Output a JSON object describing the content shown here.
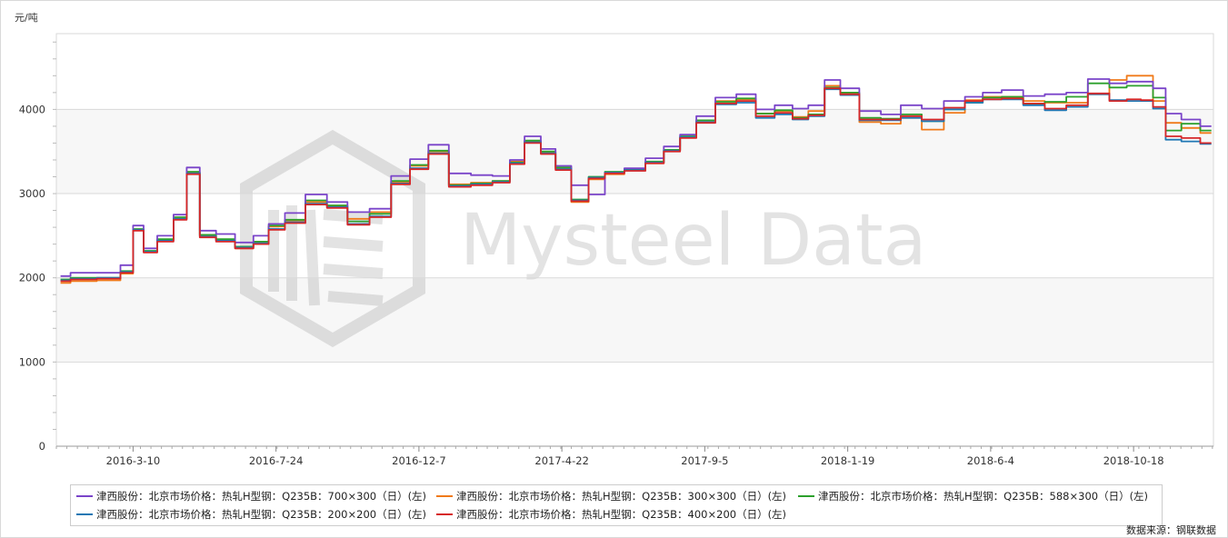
{
  "y_unit_label": "元/吨",
  "source_label": "数据来源：钢联数据",
  "watermark": "Mysteel Data",
  "colors": {
    "s700x300": "#7a44c9",
    "s300x300": "#f07a1a",
    "s588x300": "#2ca02c",
    "s200x200": "#1f77b4",
    "s400x200": "#d62728"
  },
  "chart_data": {
    "type": "line",
    "title": "",
    "xlabel": "",
    "ylabel": "元/吨",
    "ylim": [
      0,
      4900
    ],
    "yticks": [
      0,
      1000,
      2000,
      3000,
      4000
    ],
    "grid": true,
    "legend_position": "bottom",
    "x_tick_labels": [
      "2016-3-10",
      "2016-7-24",
      "2016-12-7",
      "2017-4-22",
      "2017-9-5",
      "2018-1-19",
      "2018-6-4",
      "2018-10-18"
    ],
    "x": [
      "2016-1-1",
      "2016-1-20",
      "2016-2-20",
      "2016-3-5",
      "2016-3-15",
      "2016-3-25",
      "2016-4-10",
      "2016-4-25",
      "2016-5-5",
      "2016-5-20",
      "2016-6-5",
      "2016-6-25",
      "2016-7-10",
      "2016-7-24",
      "2016-8-10",
      "2016-9-1",
      "2016-9-20",
      "2016-10-10",
      "2016-11-1",
      "2016-11-20",
      "2016-12-7",
      "2016-12-25",
      "2017-1-15",
      "2017-2-5",
      "2017-2-25",
      "2017-3-10",
      "2017-3-25",
      "2017-4-10",
      "2017-4-22",
      "2017-5-10",
      "2017-5-25",
      "2017-6-10",
      "2017-7-1",
      "2017-7-20",
      "2017-8-5",
      "2017-8-20",
      "2017-9-5",
      "2017-9-25",
      "2017-10-15",
      "2017-11-1",
      "2017-11-20",
      "2017-12-5",
      "2017-12-20",
      "2018-1-5",
      "2018-1-19",
      "2018-2-10",
      "2018-3-1",
      "2018-3-20",
      "2018-4-10",
      "2018-5-1",
      "2018-5-20",
      "2018-6-4",
      "2018-6-25",
      "2018-7-15",
      "2018-8-5",
      "2018-8-25",
      "2018-9-15",
      "2018-10-5",
      "2018-10-18",
      "2018-11-1",
      "2018-11-10",
      "2018-11-25",
      "2018-12-10",
      "2018-12-31"
    ],
    "series": [
      {
        "name": "津西股份：北京市场价格：热轧H型钢：Q235B：700×300（日）(左)",
        "color_key": "s700x300",
        "values": [
          2020,
          2060,
          2060,
          2150,
          2620,
          2350,
          2500,
          2750,
          3310,
          2560,
          2520,
          2420,
          2500,
          2640,
          2770,
          2990,
          2900,
          2780,
          2820,
          3210,
          3410,
          3580,
          3240,
          3220,
          3210,
          3400,
          3680,
          3530,
          3330,
          3100,
          2990,
          3250,
          3300,
          3420,
          3560,
          3700,
          3920,
          4140,
          4180,
          4000,
          4050,
          4010,
          4050,
          4350,
          4250,
          3980,
          3940,
          4050,
          4010,
          4100,
          4150,
          4200,
          4230,
          4160,
          4180,
          4200,
          4360,
          4310,
          4330,
          4330,
          4250,
          3950,
          3880,
          3800
        ]
      },
      {
        "name": "津西股份：北京市场价格：热轧H型钢：Q235B：300×300（日）(左)",
        "color_key": "s300x300",
        "values": [
          1940,
          1960,
          1970,
          2050,
          2570,
          2310,
          2450,
          2700,
          3250,
          2500,
          2450,
          2350,
          2420,
          2610,
          2680,
          2900,
          2850,
          2700,
          2780,
          3140,
          3330,
          3500,
          3110,
          3130,
          3150,
          3380,
          3620,
          3490,
          3300,
          2900,
          3170,
          3230,
          3280,
          3360,
          3510,
          3670,
          3870,
          4100,
          4120,
          3950,
          3980,
          3910,
          3980,
          4280,
          4190,
          3850,
          3830,
          3900,
          3760,
          3960,
          4110,
          4150,
          4150,
          4100,
          4080,
          4080,
          4180,
          4350,
          4400,
          4400,
          4100,
          3840,
          3780,
          3720
        ]
      },
      {
        "name": "津西股份：北京市场价格：热轧H型钢：Q235B：588×300（日）(左)",
        "color_key": "s588x300",
        "values": [
          1980,
          2000,
          2000,
          2080,
          2580,
          2320,
          2460,
          2720,
          3260,
          2510,
          2460,
          2370,
          2430,
          2620,
          2690,
          2920,
          2860,
          2670,
          2760,
          3150,
          3340,
          3510,
          3100,
          3120,
          3150,
          3370,
          3630,
          3500,
          3310,
          2930,
          3200,
          3260,
          3290,
          3380,
          3520,
          3680,
          3870,
          4090,
          4130,
          3950,
          3990,
          3900,
          3940,
          4260,
          4200,
          3900,
          3890,
          3940,
          3860,
          4000,
          4080,
          4140,
          4150,
          4060,
          4090,
          4150,
          4310,
          4260,
          4280,
          4280,
          4140,
          3750,
          3830,
          3750
        ]
      },
      {
        "name": "津西股份：北京市场价格：热轧H型钢：Q235B：200×200（日）(左)",
        "color_key": "s200x200",
        "values": [
          1970,
          1990,
          2000,
          2070,
          2570,
          2310,
          2440,
          2700,
          3240,
          2490,
          2440,
          2360,
          2410,
          2580,
          2660,
          2880,
          2840,
          2640,
          2730,
          3120,
          3300,
          3480,
          3090,
          3110,
          3140,
          3360,
          3610,
          3480,
          3290,
          2920,
          3190,
          3250,
          3280,
          3370,
          3510,
          3670,
          3850,
          4060,
          4080,
          3900,
          3940,
          3880,
          3920,
          4240,
          4170,
          3870,
          3870,
          3900,
          3860,
          4000,
          4080,
          4120,
          4120,
          4050,
          3990,
          4030,
          4180,
          4110,
          4100,
          4100,
          4010,
          3640,
          3620,
          3590
        ]
      },
      {
        "name": "津西股份：北京市场价格：热轧H型钢：Q235B：400×200（日）(左)",
        "color_key": "s400x200",
        "values": [
          1960,
          1980,
          1990,
          2060,
          2560,
          2300,
          2430,
          2690,
          3230,
          2480,
          2430,
          2350,
          2400,
          2570,
          2650,
          2870,
          2830,
          2630,
          2720,
          3110,
          3290,
          3470,
          3080,
          3100,
          3130,
          3350,
          3600,
          3470,
          3280,
          2910,
          3180,
          3240,
          3270,
          3360,
          3500,
          3660,
          3840,
          4070,
          4100,
          3920,
          3960,
          3890,
          3930,
          4250,
          4180,
          3880,
          3880,
          3920,
          3880,
          4020,
          4100,
          4120,
          4130,
          4070,
          4010,
          4050,
          4190,
          4100,
          4120,
          4110,
          4030,
          3680,
          3660,
          3600
        ]
      }
    ]
  }
}
